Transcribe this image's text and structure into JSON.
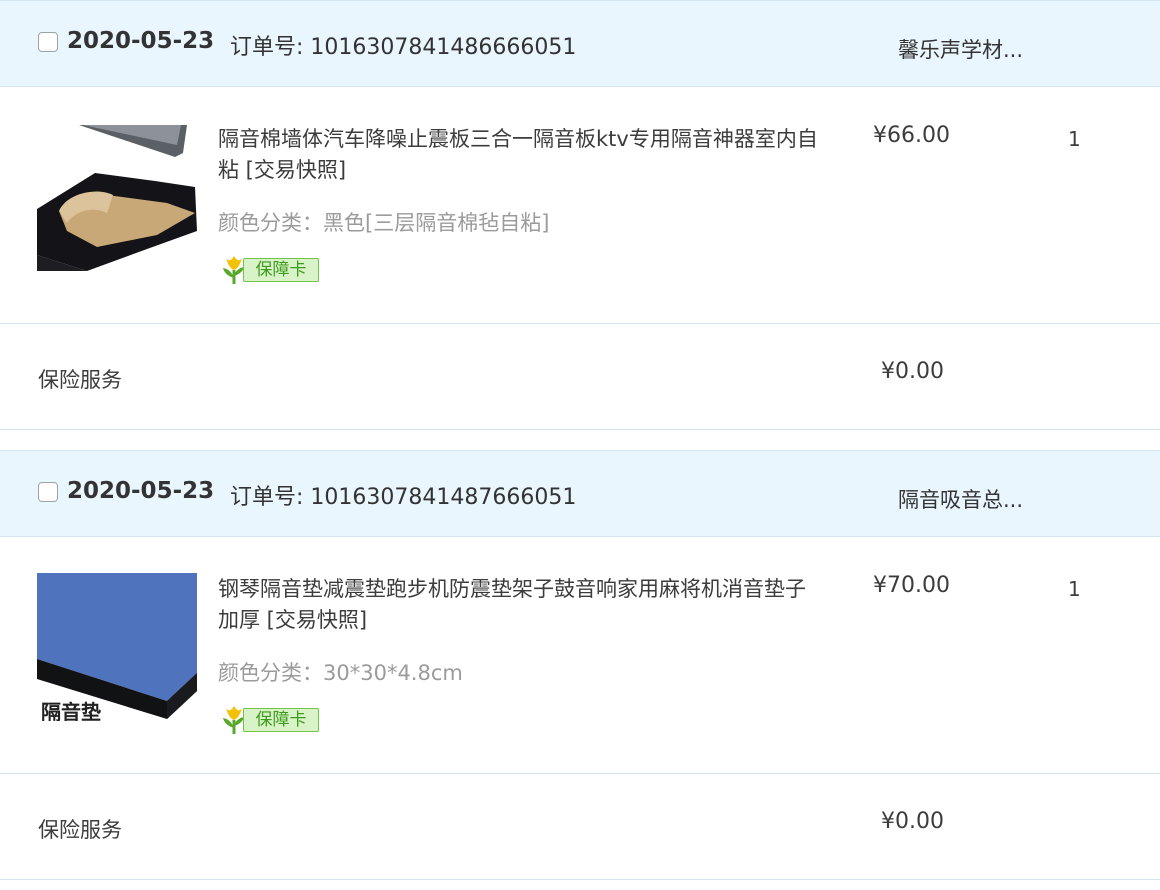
{
  "orders": [
    {
      "date": "2020-05-23",
      "order_label": "订单号: 1016307841486666051",
      "shop": "馨乐声学材...",
      "product_title": "隔音棉墙体汽车降噪止震板三合一隔音板ktv专用隔音神器室内自粘 [交易快照]",
      "sku": "颜色分类：黑色[三层隔音棉毡自粘]",
      "badge": "保障卡",
      "price": "¥66.00",
      "quantity": "1",
      "service_label": "保险服务",
      "service_price": "¥0.00",
      "thumbnail_icon": "black-foam-sheet-image"
    },
    {
      "date": "2020-05-23",
      "order_label": "订单号: 1016307841487666051",
      "shop": "隔音吸音总...",
      "product_title": "钢琴隔音垫减震垫跑步机防震垫架子鼓音响家用麻将机消音垫子加厚 [交易快照]",
      "sku": "颜色分类：30*30*4.8cm",
      "badge": "保障卡",
      "price": "¥70.00",
      "quantity": "1",
      "service_label": "保险服务",
      "service_price": "¥0.00",
      "thumbnail_text": "隔音垫",
      "thumbnail_icon": "blue-pad-image"
    }
  ],
  "colors": {
    "header_bg": "#eaf6fd",
    "border": "#d2e6f5",
    "badge_green": "#3d9a1a"
  }
}
